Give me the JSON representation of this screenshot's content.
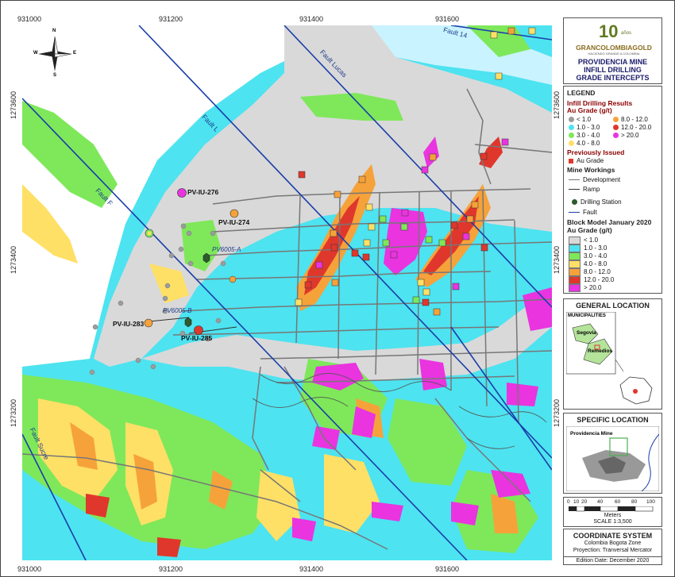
{
  "map": {
    "x_ticks": [
      "931000",
      "931200",
      "931400",
      "931600"
    ],
    "y_ticks": [
      "1273600",
      "1273400",
      "1273200"
    ],
    "north_arrow": {
      "n": "N",
      "s": "S",
      "e": "E",
      "w": "W"
    },
    "faults": [
      "Fault 14",
      "Fault Lucas",
      "Fault L",
      "Fault F",
      "Fault Sucre"
    ],
    "drillholes": [
      "PV-IU-276",
      "PV-IU-274",
      "PV-IU-283",
      "PV-IU-285"
    ],
    "stations": [
      "PV6005-A",
      "PV6005-B"
    ],
    "colors": {
      "water": "#c9f3ff",
      "low": "#d9d9d9",
      "cyan": "#4de3f0",
      "green": "#7ee85a",
      "yellow": "#ffe066",
      "orange": "#f6a23a",
      "red": "#e0372c",
      "magenta": "#e934e0",
      "fault": "#1a3ea8"
    }
  },
  "header": {
    "logo_top": "10",
    "logo_years": "años",
    "logo_name": "GRANCOLOMBIAGOLD",
    "logo_sub": "HACIENDO GRANDE A COLOMBIA",
    "title_lines": [
      "PROVIDENCIA MINE",
      "INFILL DRILLING",
      "GRADE INTERCEPTS"
    ]
  },
  "legend": {
    "title": "LEGEND",
    "drill_title": "Infill Drilling Results",
    "drill_sub": "Au Grade (g/t)",
    "drill_items_left": [
      "< 1.0",
      "1.0 - 3.0",
      "3.0 - 4.0",
      "4.0 - 8.0"
    ],
    "drill_items_right": [
      "8.0 - 12.0",
      "12.0 - 20.0",
      "> 20.0"
    ],
    "prev_title": "Previously Issued",
    "prev_item": "Au Grade",
    "workings_title": "Mine Workings",
    "workings_items": [
      "Development",
      "Ramp"
    ],
    "station_item": "Drilling Station",
    "fault_item": "Fault",
    "block_title": "Block Model January 2020",
    "block_sub": "Au Grade (g/t)",
    "block_items": [
      "< 1.0",
      "1.0 - 3.0",
      "3.0 - 4.0",
      "4.0 - 8.0",
      "8.0 - 12.0",
      "12.0 - 20.0",
      "> 20.0"
    ]
  },
  "general_location": {
    "title": "GENERAL LOCATION",
    "box_title": "MUNICIPALITIES",
    "places": [
      "Segovia",
      "Remedios"
    ]
  },
  "specific_location": {
    "title": "SPECIFIC LOCATION",
    "place": "Providencia Mine"
  },
  "scale": {
    "ticks": [
      "0",
      "10",
      "20",
      "40",
      "60",
      "80",
      "100"
    ],
    "unit": "Meters",
    "ratio": "SCALE 1:3,500"
  },
  "coordinate_system": {
    "title": "COORDINATE SYSTEM",
    "zone": "Colombia Bogota Zone",
    "projection": "Proyection: Tranversal Mercator",
    "edition": "Edition Date: December 2020"
  }
}
